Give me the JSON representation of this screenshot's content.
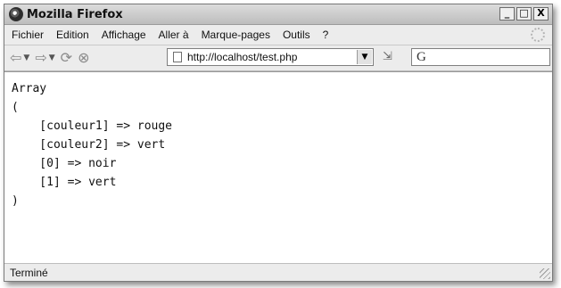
{
  "window": {
    "title": "Mozilla Firefox",
    "controls": {
      "minimize": "_",
      "maximize": "□",
      "close": "X"
    }
  },
  "menu": {
    "items": [
      "Fichier",
      "Edition",
      "Affichage",
      "Aller à",
      "Marque-pages",
      "Outils",
      "?"
    ]
  },
  "nav": {
    "back_icon": "back-arrow-icon",
    "forward_icon": "forward-arrow-icon",
    "reload_icon": "reload-icon",
    "stop_icon": "stop-icon",
    "url": "http://localhost/test.php",
    "search_engine_icon": "G"
  },
  "content": {
    "lines": [
      "Array",
      "(",
      "    [couleur1] => rouge",
      "    [couleur2] => vert",
      "    [0] => noir",
      "    [1] => vert",
      ")"
    ]
  },
  "status": {
    "text": "Terminé"
  }
}
